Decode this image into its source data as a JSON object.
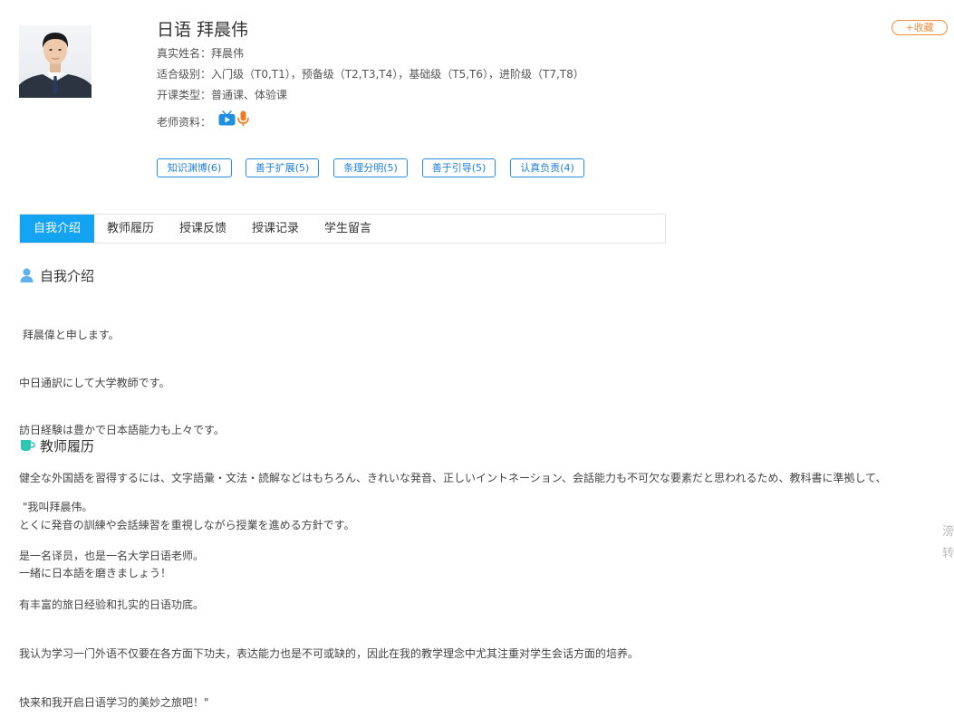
{
  "teacher": {
    "display_name": "日语 拜晨伟",
    "real_name": "真实姓名：拜晨伟",
    "levels": "适合级别：入门级（T0,T1），预备级（T2,T3,T4），基础级（T5,T6），进阶级（T7,T8）",
    "course_types": "开课类型：普通课、体验课",
    "materials_label": "老师资料："
  },
  "favorite_label": "+收藏",
  "tags": [
    "知识渊博(6)",
    "善于扩展(5)",
    "条理分明(5)",
    "善于引导(5)",
    "认真负责(4)"
  ],
  "tabs": [
    "自我介绍",
    "教师履历",
    "授课反馈",
    "授课记录",
    "学生留言"
  ],
  "active_tab": "自我介绍",
  "intro": {
    "title": "自我介绍",
    "lines": [
      " 拜晨偉と申します。",
      "中日通訳にして大学教師です。",
      "訪日経験は豊かで日本語能力も上々です。",
      "健全な外国語を習得するには、文字語彙・文法・読解などはもちろん、きれいな発音、正しいイントネーション、会話能力も不可欠な要素だと思われるため、教科書に準拠して、",
      "とくに発音の訓練や会話練習を重視しながら授業を進める方針です。",
      "一緒に日本語を磨きましょう！"
    ]
  },
  "resume": {
    "title": "教师履历",
    "lines": [
      " \"我叫拜晨伟。",
      "是一名译员，也是一名大学日语老师。",
      "有丰富的旅日经验和扎实的日语功底。",
      "我认为学习一门外语不仅要在各方面下功夫，表达能力也是不可或缺的，因此在我的教学理念中尤其注重对学生会话方面的培养。",
      "快来和我开启日语学习的美妙之旅吧！\""
    ]
  },
  "edge_chars": [
    "滂",
    "转"
  ],
  "colors": {
    "accent": "#14a3f1",
    "tag_border": "#2b8de0",
    "favorite": "#f08d3c"
  }
}
